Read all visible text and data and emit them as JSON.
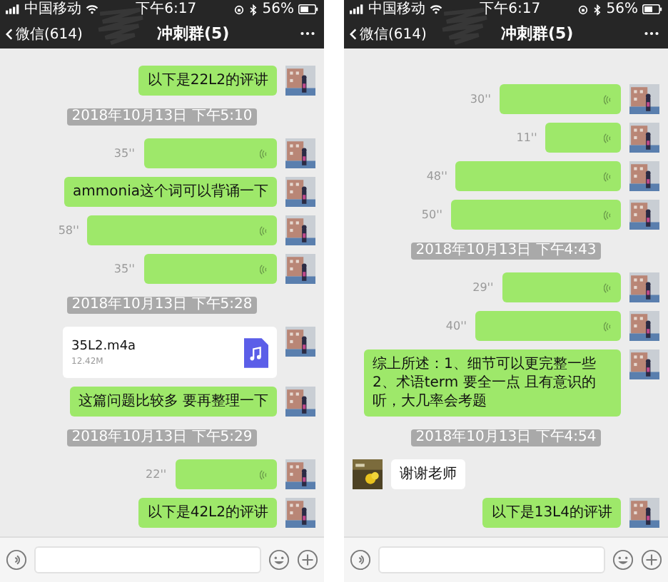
{
  "phones": [
    {
      "status_bar": {
        "carrier": "中国移动",
        "time": "下午6:17",
        "battery": "56%"
      },
      "nav": {
        "back": "微信(614)",
        "title": "冲刺群(5)"
      },
      "messages": [
        {
          "kind": "text",
          "mine": true,
          "text": "以下是22L2的评讲"
        },
        {
          "kind": "timestamp",
          "text": "2018年10月13日 下午5:10"
        },
        {
          "kind": "voice",
          "mine": true,
          "duration": "35''"
        },
        {
          "kind": "text",
          "mine": true,
          "text": "ammonia这个词可以背诵一下"
        },
        {
          "kind": "voice",
          "mine": true,
          "duration": "58''"
        },
        {
          "kind": "voice",
          "mine": true,
          "duration": "35''"
        },
        {
          "kind": "timestamp",
          "text": "2018年10月13日 下午5:28"
        },
        {
          "kind": "file",
          "mine": true,
          "name": "35L2.m4a",
          "size": "12.42M"
        },
        {
          "kind": "text",
          "mine": true,
          "text": "这篇问题比较多 要再整理一下"
        },
        {
          "kind": "timestamp",
          "text": "2018年10月13日 下午5:29"
        },
        {
          "kind": "voice",
          "mine": true,
          "duration": "22''"
        },
        {
          "kind": "text",
          "mine": true,
          "text": "以下是42L2的评讲"
        }
      ]
    },
    {
      "status_bar": {
        "carrier": "中国移动",
        "time": "下午6:17",
        "battery": "56%"
      },
      "nav": {
        "back": "微信(614)",
        "title": "冲刺群(5)"
      },
      "messages": [
        {
          "kind": "voice",
          "mine": true,
          "duration": "30''"
        },
        {
          "kind": "voice",
          "mine": true,
          "duration": "11''"
        },
        {
          "kind": "voice",
          "mine": true,
          "duration": "48''"
        },
        {
          "kind": "voice",
          "mine": true,
          "duration": "50''"
        },
        {
          "kind": "timestamp",
          "text": "2018年10月13日 下午4:43"
        },
        {
          "kind": "voice",
          "mine": true,
          "duration": "29''"
        },
        {
          "kind": "voice",
          "mine": true,
          "duration": "40''"
        },
        {
          "kind": "text",
          "mine": true,
          "text": "综上所述：1、细节可以更完整一些\n2、术语term 要全一点 且有意识的听，大几率会考题"
        },
        {
          "kind": "timestamp",
          "text": "2018年10月13日 下午4:54"
        },
        {
          "kind": "text",
          "mine": false,
          "text": "谢谢老师"
        },
        {
          "kind": "text",
          "mine": true,
          "text": "以下是13L4的评讲"
        }
      ]
    }
  ]
}
